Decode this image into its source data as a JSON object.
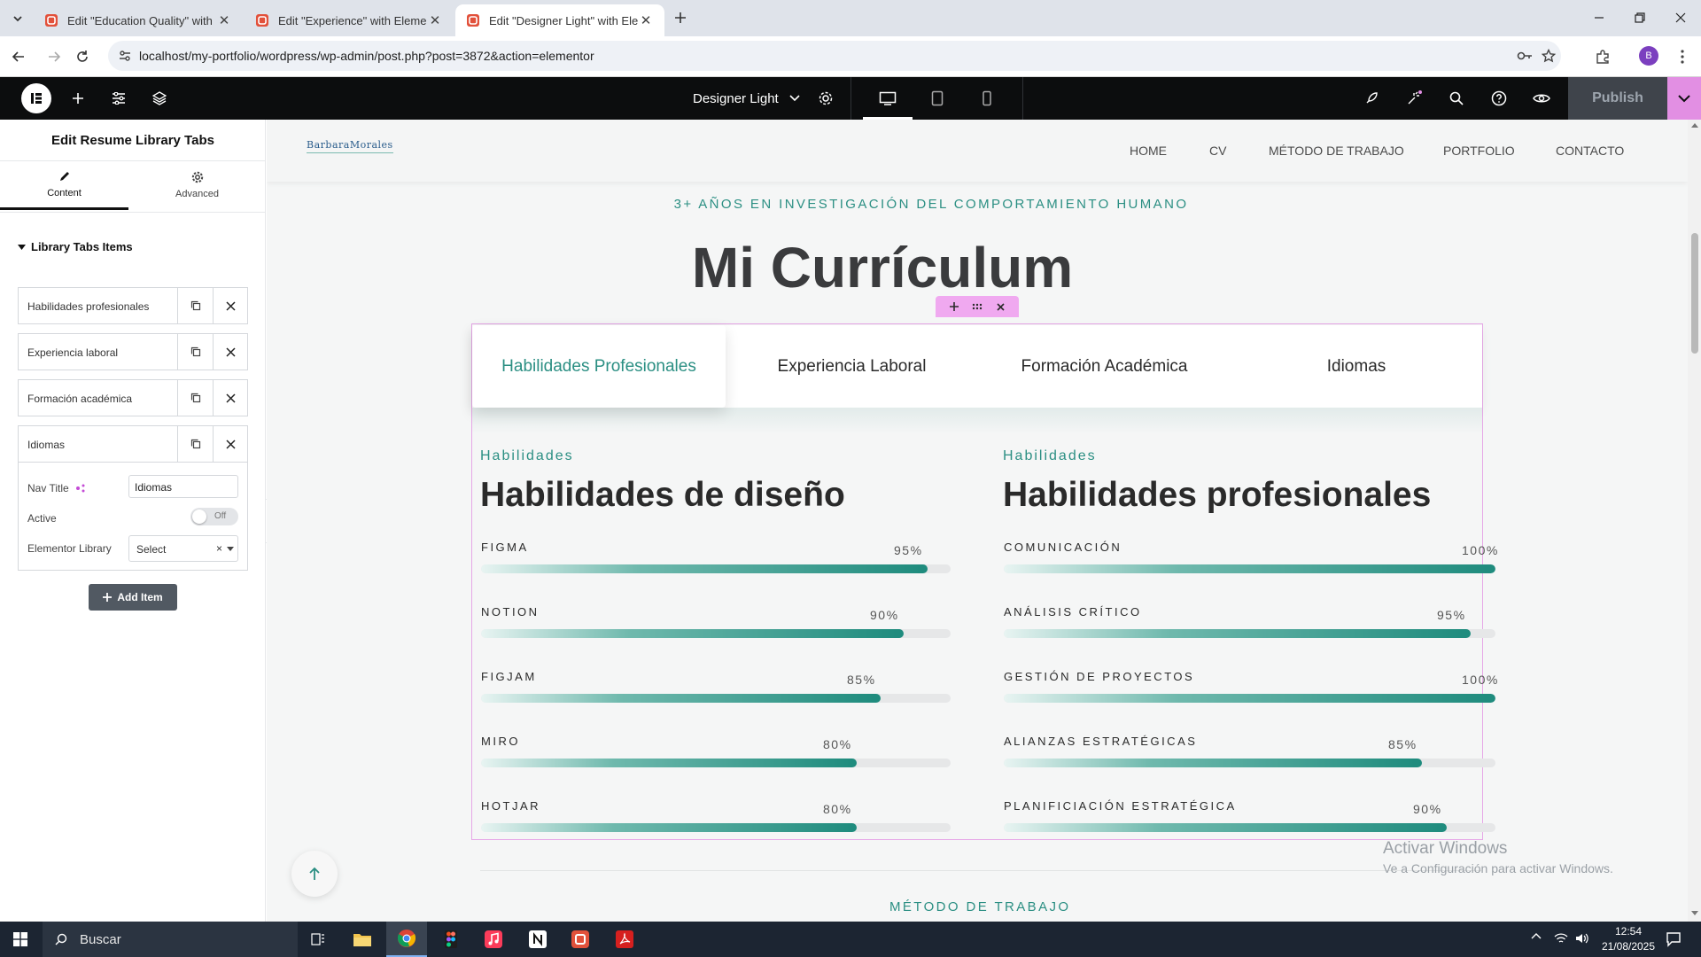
{
  "browser": {
    "tabs": [
      {
        "title": "Edit \"Education Quality\" with El"
      },
      {
        "title": "Edit \"Experience\" with Elemento"
      },
      {
        "title": "Edit \"Designer Light\" with Elem"
      }
    ],
    "url": "localhost/my-portfolio/wordpress/wp-admin/post.php?post=3872&action=elementor",
    "profile_initial": "B"
  },
  "editor": {
    "page_name": "Designer Light",
    "publish_label": "Publish"
  },
  "panel": {
    "title": "Edit Resume Library Tabs",
    "tab_content": "Content",
    "tab_advanced": "Advanced",
    "section_title": "Library Tabs Items",
    "items": [
      {
        "label": "Habilidades profesionales"
      },
      {
        "label": "Experiencia laboral"
      },
      {
        "label": "Formación académica"
      },
      {
        "label": "Idiomas"
      }
    ],
    "nav_title_label": "Nav Title",
    "nav_title_value": "Idiomas",
    "active_label": "Active",
    "active_toggle": "Off",
    "library_label": "Elementor Library",
    "library_select": "Select",
    "add_item": "Add Item"
  },
  "site": {
    "logo_text": "BarbaraMorales",
    "nav": [
      "HOME",
      "CV",
      "MÉTODO DE TRABAJO",
      "PORTFOLIO",
      "CONTACTO"
    ],
    "kicker": "3+ AÑOS EN INVESTIGACIÓN DEL COMPORTAMIENTO HUMANO",
    "heading": "Mi Currículum",
    "tabs": [
      "Habilidades Profesionales",
      "Experiencia Laboral",
      "Formación Académica",
      "Idiomas"
    ],
    "col1": {
      "eyebrow": "Habilidades",
      "title": "Habilidades de diseño",
      "skills": [
        {
          "name": "FIGMA",
          "pct": "95%",
          "value": 95
        },
        {
          "name": "NOTION",
          "pct": "90%",
          "value": 90
        },
        {
          "name": "FIGJAM",
          "pct": "85%",
          "value": 85
        },
        {
          "name": "MIRO",
          "pct": "80%",
          "value": 80
        },
        {
          "name": "HOTJAR",
          "pct": "80%",
          "value": 80
        }
      ]
    },
    "col2": {
      "eyebrow": "Habilidades",
      "title": "Habilidades profesionales",
      "skills": [
        {
          "name": "COMUNICACIÓN",
          "pct": "100%",
          "value": 100
        },
        {
          "name": "ANÁLISIS CRÍTICO",
          "pct": "95%",
          "value": 95
        },
        {
          "name": "GESTIÓN DE PROYECTOS",
          "pct": "100%",
          "value": 100
        },
        {
          "name": "ALIANZAS ESTRATÉGICAS",
          "pct": "85%",
          "value": 85
        },
        {
          "name": "PLANIFICIACIÓN ESTRATÉGICA",
          "pct": "90%",
          "value": 90
        }
      ]
    },
    "next_section": "MÉTODO DE TRABAJO",
    "watermark_title": "Activar Windows",
    "watermark_sub": "Ve a Configuración para activar Windows."
  },
  "taskbar": {
    "search_placeholder": "Buscar",
    "time": "12:54",
    "date": "21/08/2025"
  },
  "colors": {
    "accent": "#1e8b7d",
    "elementor_pink": "#e28fe3",
    "dark": "#0c0d0e"
  }
}
